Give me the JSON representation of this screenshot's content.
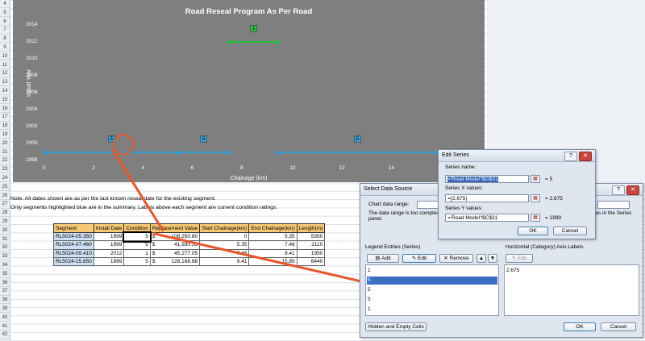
{
  "row_numbers": [
    "4",
    "5",
    "6",
    "7",
    "8",
    "9",
    "10",
    "11",
    "12",
    "13",
    "14",
    "15",
    "16",
    "17",
    "18",
    "19",
    "20",
    "21",
    "22",
    "23",
    "24",
    "25",
    "26",
    "27",
    "28",
    "29",
    "30",
    "31",
    "32",
    "33",
    "34",
    "35",
    "36",
    "37",
    "38",
    "39",
    "40",
    "41",
    "42"
  ],
  "chart": {
    "title": "Road Reseal Program As Per Road",
    "ylabel": "Install Year",
    "xlabel": "Chainage (km)",
    "yticks": [
      "2014",
      "2012",
      "2010",
      "2008",
      "2006",
      "2004",
      "2002",
      "2000",
      "1998"
    ],
    "xticks": [
      "0",
      "2",
      "4",
      "6",
      "8",
      "10",
      "12",
      "14",
      "16"
    ]
  },
  "chart_data": {
    "type": "line",
    "title": "Road Reseal Program As Per Road",
    "xlabel": "Chainage (km)",
    "ylabel": "Install Year",
    "xlim": [
      0,
      16
    ],
    "ylim": [
      1998,
      2014
    ],
    "series": [
      {
        "x": [
          0,
          5.35
        ],
        "y": [
          1999,
          1999
        ],
        "label": "5",
        "color": "#2f9fd8"
      },
      {
        "x": [
          5.35,
          7.46
        ],
        "y": [
          1999,
          1999
        ],
        "label": "5",
        "color": "#2f9fd8"
      },
      {
        "x": [
          7.46,
          9.41
        ],
        "y": [
          2012,
          2012
        ],
        "label": "1",
        "color": "#22c33a"
      },
      {
        "x": [
          9.41,
          15.85
        ],
        "y": [
          1999,
          1999
        ],
        "label": "5",
        "color": "#2f9fd8"
      }
    ]
  },
  "notes": {
    "line1": "Note:  All dates shown are as per the last known reseal date for the existing segment.",
    "line2": "Only segments highlighted blue are in the summary. Labels above each segment are current condition ratings."
  },
  "table": {
    "headers": [
      "Segment",
      "Install Date",
      "Condition",
      "Replacement Value",
      "Start Chainage(km)",
      "End Chainage(km)",
      "Length(m)"
    ],
    "rows": [
      {
        "segment": "RL5024-05.350",
        "install": "1999",
        "condition": "5",
        "dollar": "$",
        "value": "108,250.80",
        "start": "0",
        "end": "5.35",
        "length": "5350"
      },
      {
        "segment": "RL5024-07.460",
        "install": "1999",
        "condition": "5",
        "dollar": "$",
        "value": "41,930.53",
        "start": "5.35",
        "end": "7.46",
        "length": "2110"
      },
      {
        "segment": "RL5024-09.410",
        "install": "2012",
        "condition": "1",
        "dollar": "$",
        "value": "45,277.05",
        "start": "7.46",
        "end": "9.41",
        "length": "1950"
      },
      {
        "segment": "RL5024-15.850",
        "install": "1999",
        "condition": "5",
        "dollar": "$",
        "value": "128,168.88",
        "start": "9.41",
        "end": "15.85",
        "length": "6440"
      }
    ]
  },
  "select_data_source": {
    "title": "Select Data Source",
    "chart_range_label": "Chart data range:",
    "info_text": "The data range is too complex to",
    "info_text2": "panel.",
    "info_text_right": "les in the Series",
    "legend_label": "Legend Entries (Series)",
    "axis_label": "Horizontal (Category) Axis Labels",
    "add": "Add",
    "edit": "Edit",
    "remove": "Remove",
    "axis_edit": "Edit",
    "series_items": [
      "1",
      "5",
      "5",
      "5",
      "1"
    ],
    "axis_items": [
      "2.675"
    ],
    "hidden_cells": "Hidden and Empty Cells",
    "ok": "OK",
    "cancel": "Cancel"
  },
  "edit_series": {
    "title": "Edit Series",
    "name_label": "Series name:",
    "name_value": "='Road Model'!$G$31",
    "name_result": "= 5",
    "x_label": "Series X values:",
    "x_value": "={2.675}",
    "x_result": "= 2.675",
    "y_label": "Series Y values:",
    "y_value": "='Road Model'!$C$31",
    "y_result": "= 1999",
    "ok": "OK",
    "cancel": "Cancel"
  }
}
